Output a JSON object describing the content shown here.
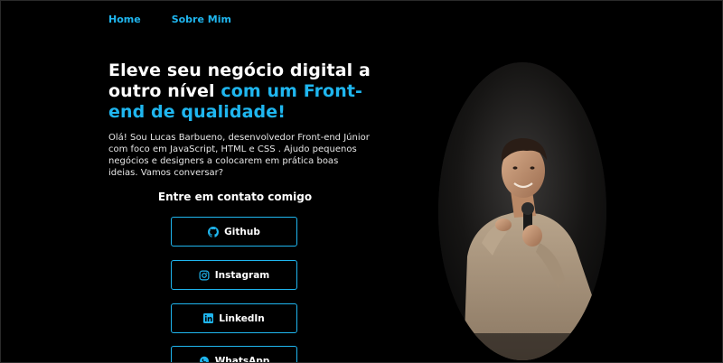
{
  "nav": {
    "home": "Home",
    "about": "Sobre Mim"
  },
  "hero": {
    "headline_plain": "Eleve seu negócio digital a outro nível ",
    "headline_accent": "com um Front-end de qualidade!",
    "intro": "Olá! Sou Lucas Barbueno, desenvolvedor Front-end Júnior com foco em JavaScript, HTML e CSS . Ajudo pequenos negócios e designers a colocarem em prática boas ideias. Vamos conversar?"
  },
  "contact": {
    "title": "Entre em contato comigo",
    "buttons": [
      {
        "label": "Github",
        "icon": "github-icon"
      },
      {
        "label": "Instagram",
        "icon": "instagram-icon"
      },
      {
        "label": "LinkedIn",
        "icon": "linkedin-icon"
      },
      {
        "label": "WhatsApp",
        "icon": "whatsapp-icon"
      }
    ]
  },
  "colors": {
    "accent": "#1fb6ef",
    "background": "#000000",
    "text": "#ffffff"
  }
}
